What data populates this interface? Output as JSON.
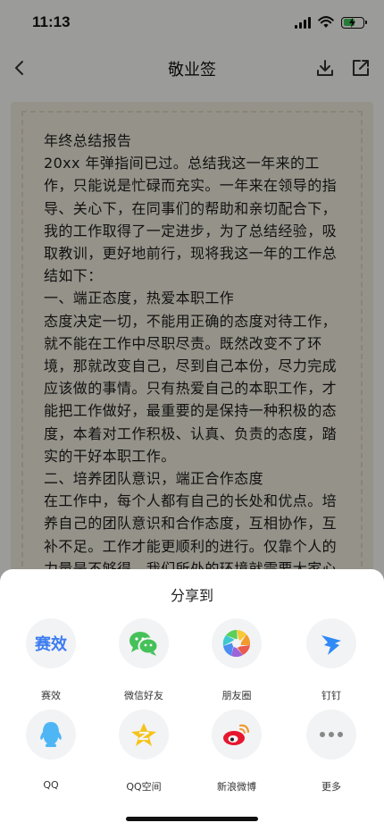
{
  "status_bar": {
    "time": "11:13",
    "icons": [
      "signal-icon",
      "wifi-icon",
      "battery-charging-icon"
    ],
    "battery_level": 0.6
  },
  "nav": {
    "title": "敬业签",
    "back_icon": "chevron-left-icon",
    "download_icon": "download-icon",
    "share_icon": "share-out-icon"
  },
  "document": {
    "lines": [
      "年终总结报告",
      "20xx 年弹指间已过。总结我这一年来的工作，只能说是忙碌而充实。一年来在领导的指导、关心下，在同事们的帮助和亲切配合下，我的工作取得了一定进步，为了总结经验，吸取教训，更好地前行，现将我这一年的工作总结如下：",
      "一、端正态度，热爱本职工作",
      "态度决定一切，不能用正确的态度对待工作，就不能在工作中尽职尽责。既然改变不了环境，那就改变自己，尽到自己本份，尽力完成应该做的事情。只有热爱自己的本职工作，才能把工作做好，最重要的是保持一种积极的态度，本着对工作积极、认真、负责的态度，踏实的干好本职工作。",
      "二、培养团队意识，端正合作态度",
      "在工作中，每个人都有自己的长处和优点。培养自己的团队意识和合作态度，互相协作，互补不足。工作才能更顺利的进行。仅靠个人的力量是不够得，我们所处的环境就需要大家心"
    ]
  },
  "share_sheet": {
    "title": "分享到",
    "items": [
      {
        "label": "赛效",
        "icon": "saixiao-logo-icon",
        "logo_text": "赛效",
        "color": "#3d7cf0"
      },
      {
        "label": "微信好友",
        "icon": "wechat-icon",
        "color": "#45c159"
      },
      {
        "label": "朋友圈",
        "icon": "moments-icon",
        "color": "#45c159"
      },
      {
        "label": "钉钉",
        "icon": "dingtalk-icon",
        "color": "#2f89f6"
      },
      {
        "label": "QQ",
        "icon": "qq-icon",
        "color": "#4fb6f5"
      },
      {
        "label": "QQ空间",
        "icon": "qzone-icon",
        "color": "#f5c418"
      },
      {
        "label": "新浪微博",
        "icon": "weibo-icon",
        "color": "#e6162d"
      },
      {
        "label": "更多",
        "icon": "more-icon",
        "color": "#888888"
      }
    ]
  }
}
